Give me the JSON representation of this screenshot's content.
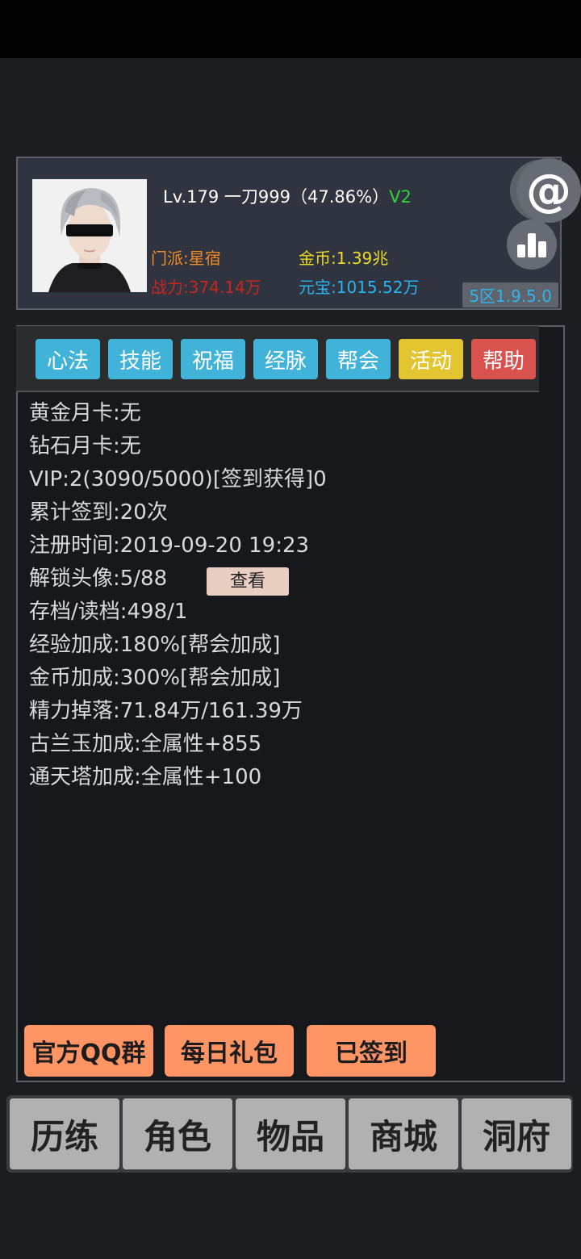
{
  "header": {
    "level_text": "Lv.179 一刀999（47.86%）",
    "vip_tag": "V2",
    "sect": "门派:星宿",
    "power": "战力:374.14万",
    "gold": "金币:1.39兆",
    "yuanbao": "元宝:1015.52万",
    "server": "5区1.9.5.0"
  },
  "icons": {
    "at": "at-icon",
    "stats": "bar-chart-icon"
  },
  "tabs": [
    {
      "label": "心法"
    },
    {
      "label": "技能"
    },
    {
      "label": "祝福"
    },
    {
      "label": "经脉"
    },
    {
      "label": "帮会"
    },
    {
      "label": "活动"
    },
    {
      "label": "帮助"
    }
  ],
  "info": [
    "黄金月卡:无",
    "钻石月卡:无",
    "VIP:2(3090/5000)[签到获得]0",
    "累计签到:20次",
    "注册时间:2019-09-20 19:23",
    "解锁头像:5/88",
    "存档/读档:498/1",
    "经验加成:180%[帮会加成]",
    "金币加成:300%[帮会加成]",
    "精力掉落:71.84万/161.39万",
    "古兰玉加成:全属性+855",
    "通天塔加成:全属性+100"
  ],
  "view_button": "查看",
  "actions": {
    "qq_group": "官方QQ群",
    "daily_gift": "每日礼包",
    "signed_in": "已签到"
  },
  "nav": [
    {
      "label": "历练"
    },
    {
      "label": "角色"
    },
    {
      "label": "物品"
    },
    {
      "label": "商城"
    },
    {
      "label": "洞府"
    }
  ],
  "colors": {
    "tab_blue": "#41b3d9",
    "tab_yellow": "#e3c531",
    "tab_red": "#d9524d",
    "action_orange": "#ff9464",
    "vip_green": "#31d23c",
    "gold_yellow": "#ecdc25",
    "yuanbao_blue": "#29b6f0",
    "sect_orange": "#f08a24",
    "power_red": "#c8261e"
  }
}
